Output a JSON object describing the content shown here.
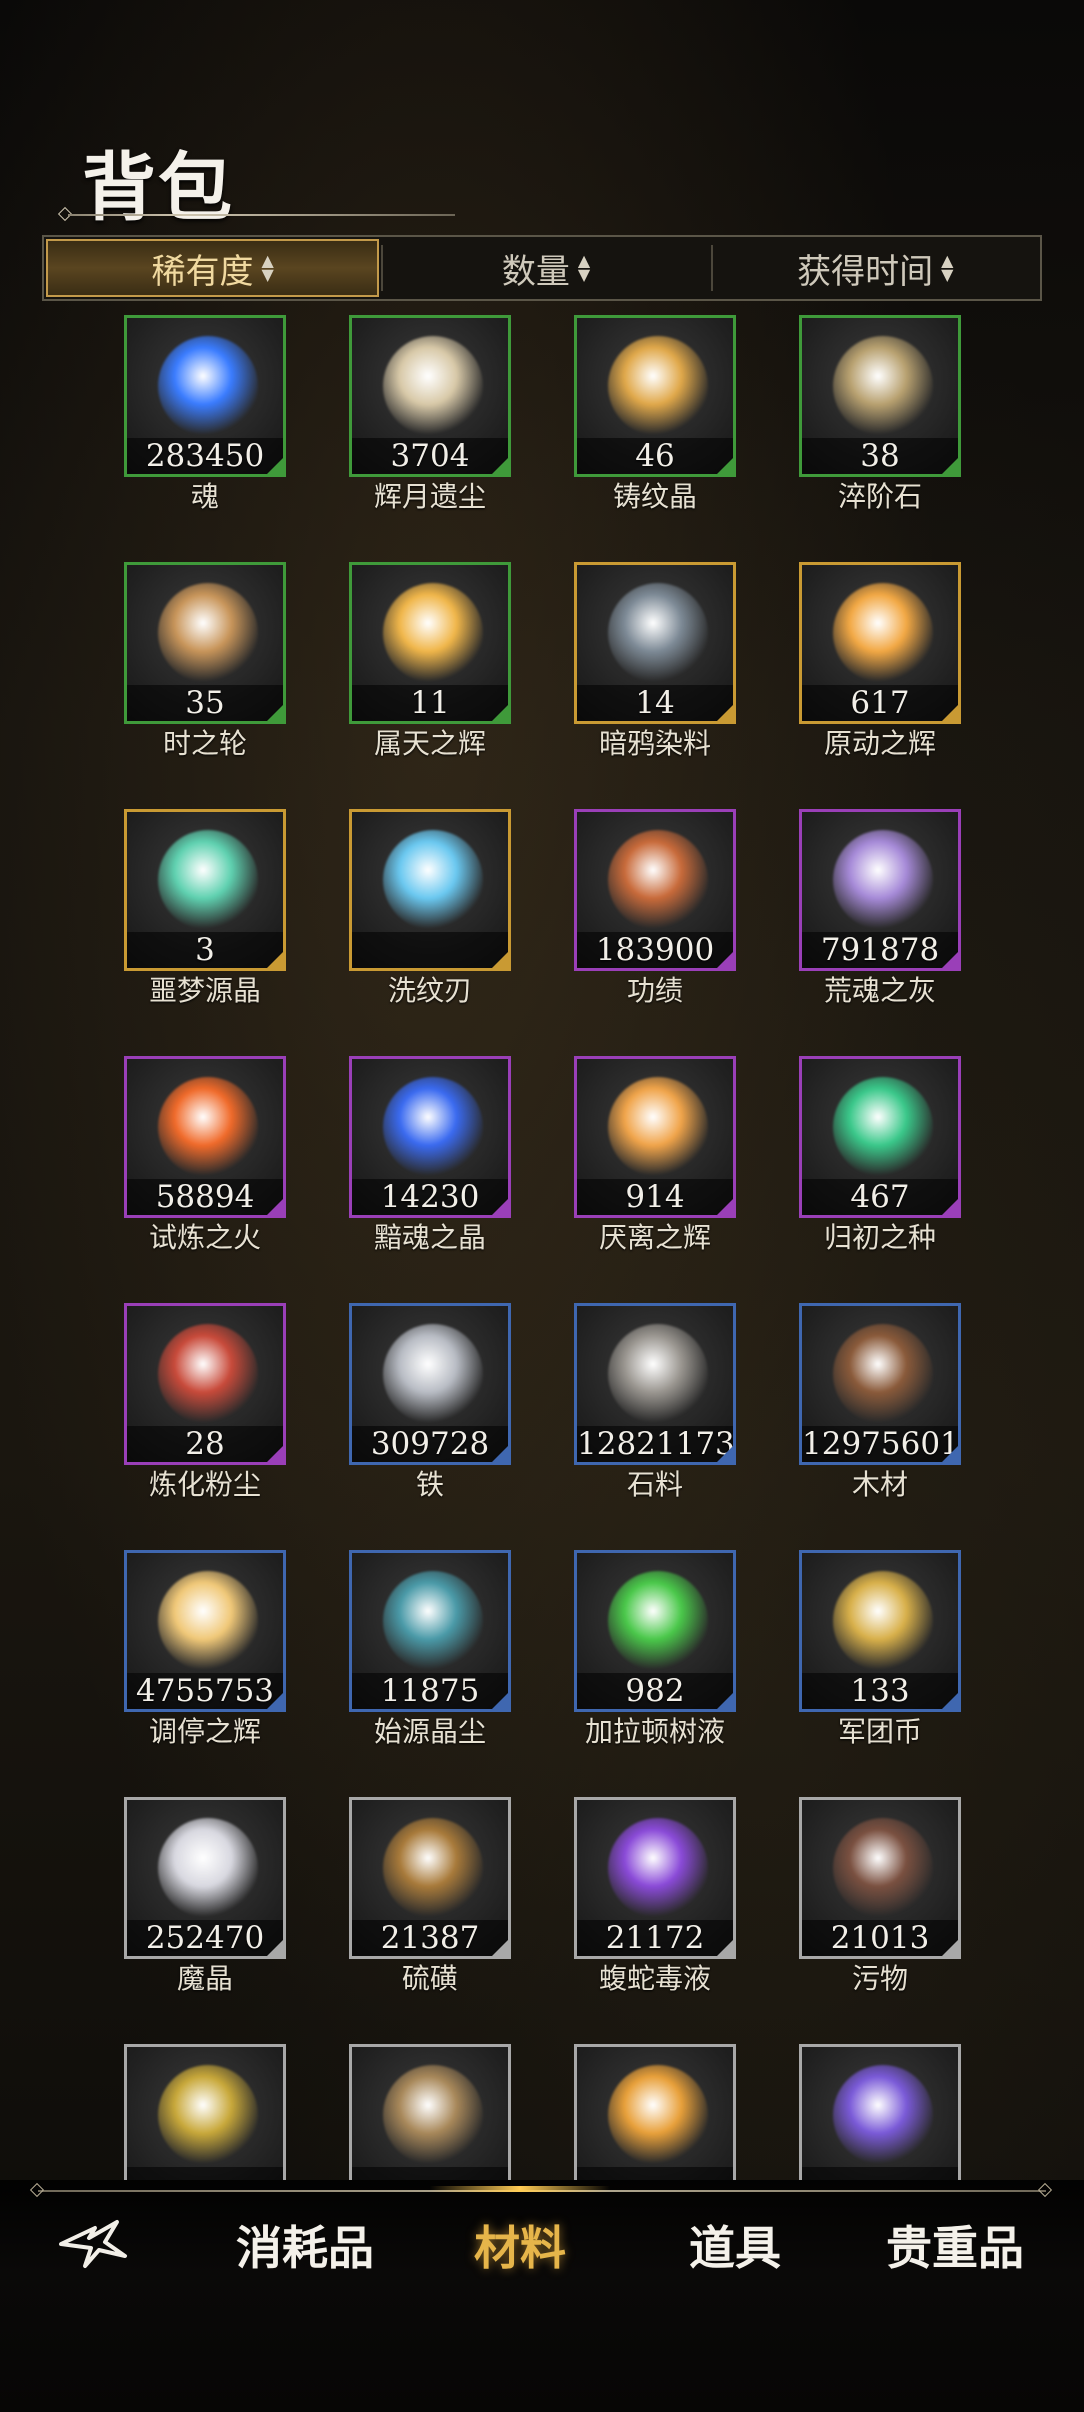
{
  "header": {
    "title": "背包"
  },
  "sort": {
    "tabs": [
      {
        "label": "稀有度",
        "active": true
      },
      {
        "label": "数量",
        "active": false
      },
      {
        "label": "获得时间",
        "active": false
      }
    ],
    "arrow_glyph": "▲▼"
  },
  "rarity_colors": {
    "green": "#3f9a3a",
    "gold": "#c99a33",
    "purple": "#9a3fb8",
    "blue": "#3f67b0",
    "white": "#a8a8a8"
  },
  "items": [
    {
      "name": "魂",
      "count": "283450",
      "rarity": "green",
      "art": "#3a7cff"
    },
    {
      "name": "辉月遗尘",
      "count": "3704",
      "rarity": "green",
      "art": "#d8c9a8"
    },
    {
      "name": "铸纹晶",
      "count": "46",
      "rarity": "green",
      "art": "#e0a84a"
    },
    {
      "name": "淬阶石",
      "count": "38",
      "rarity": "green",
      "art": "#b8a170"
    },
    {
      "name": "时之轮",
      "count": "35",
      "rarity": "green",
      "art": "#c8955a"
    },
    {
      "name": "属天之辉",
      "count": "11",
      "rarity": "green",
      "art": "#f0b64a"
    },
    {
      "name": "暗鸦染料",
      "count": "14",
      "rarity": "gold",
      "art": "#7d8a96"
    },
    {
      "name": "原动之辉",
      "count": "617",
      "rarity": "gold",
      "art": "#f2a844"
    },
    {
      "name": "噩梦源晶",
      "count": "3",
      "rarity": "gold",
      "art": "#5fd1b0"
    },
    {
      "name": "洗纹刃",
      "count": "",
      "rarity": "gold",
      "art": "#6ac8f0"
    },
    {
      "name": "功绩",
      "count": "183900",
      "rarity": "purple",
      "art": "#c86a3a"
    },
    {
      "name": "荒魂之灰",
      "count": "791878",
      "rarity": "purple",
      "art": "#a68ad8"
    },
    {
      "name": "试炼之火",
      "count": "58894",
      "rarity": "purple",
      "art": "#f06a2a"
    },
    {
      "name": "黯魂之晶",
      "count": "14230",
      "rarity": "purple",
      "art": "#3a6af0"
    },
    {
      "name": "厌离之辉",
      "count": "914",
      "rarity": "purple",
      "art": "#f0a44a"
    },
    {
      "name": "归初之种",
      "count": "467",
      "rarity": "purple",
      "art": "#3ac88a"
    },
    {
      "name": "炼化粉尘",
      "count": "28",
      "rarity": "purple",
      "art": "#c84a3a"
    },
    {
      "name": "铁",
      "count": "309728",
      "rarity": "blue",
      "art": "#b8bcc4"
    },
    {
      "name": "石料",
      "count": "12821173",
      "rarity": "blue",
      "art": "#9a9690"
    },
    {
      "name": "木材",
      "count": "12975601",
      "rarity": "blue",
      "art": "#8a5a3a"
    },
    {
      "name": "调停之辉",
      "count": "4755753",
      "rarity": "blue",
      "art": "#f0c878"
    },
    {
      "name": "始源晶尘",
      "count": "11875",
      "rarity": "blue",
      "art": "#4a9aa8"
    },
    {
      "name": "加拉顿树液",
      "count": "982",
      "rarity": "blue",
      "art": "#4ac84a"
    },
    {
      "name": "军团币",
      "count": "133",
      "rarity": "blue",
      "art": "#d8b04a"
    },
    {
      "name": "魔晶",
      "count": "252470",
      "rarity": "white",
      "art": "#d8d8e0"
    },
    {
      "name": "硫磺",
      "count": "21387",
      "rarity": "white",
      "art": "#a87a3a"
    },
    {
      "name": "蝮蛇毒液",
      "count": "21172",
      "rarity": "white",
      "art": "#8a4ad8"
    },
    {
      "name": "污物",
      "count": "21013",
      "rarity": "white",
      "art": "#7a5040"
    },
    {
      "name": "",
      "count": "",
      "rarity": "white",
      "art": "#c8a83a"
    },
    {
      "name": "",
      "count": "",
      "rarity": "white",
      "art": "#a8885a"
    },
    {
      "name": "",
      "count": "",
      "rarity": "white",
      "art": "#e8a03a"
    },
    {
      "name": "",
      "count": "",
      "rarity": "white",
      "art": "#7a5ad8"
    }
  ],
  "bottom_nav": {
    "back_icon": "back-arrow-icon",
    "tabs": [
      {
        "label": "消耗品",
        "active": false
      },
      {
        "label": "材料",
        "active": true
      },
      {
        "label": "道具",
        "active": false
      },
      {
        "label": "贵重品",
        "active": false
      }
    ]
  }
}
